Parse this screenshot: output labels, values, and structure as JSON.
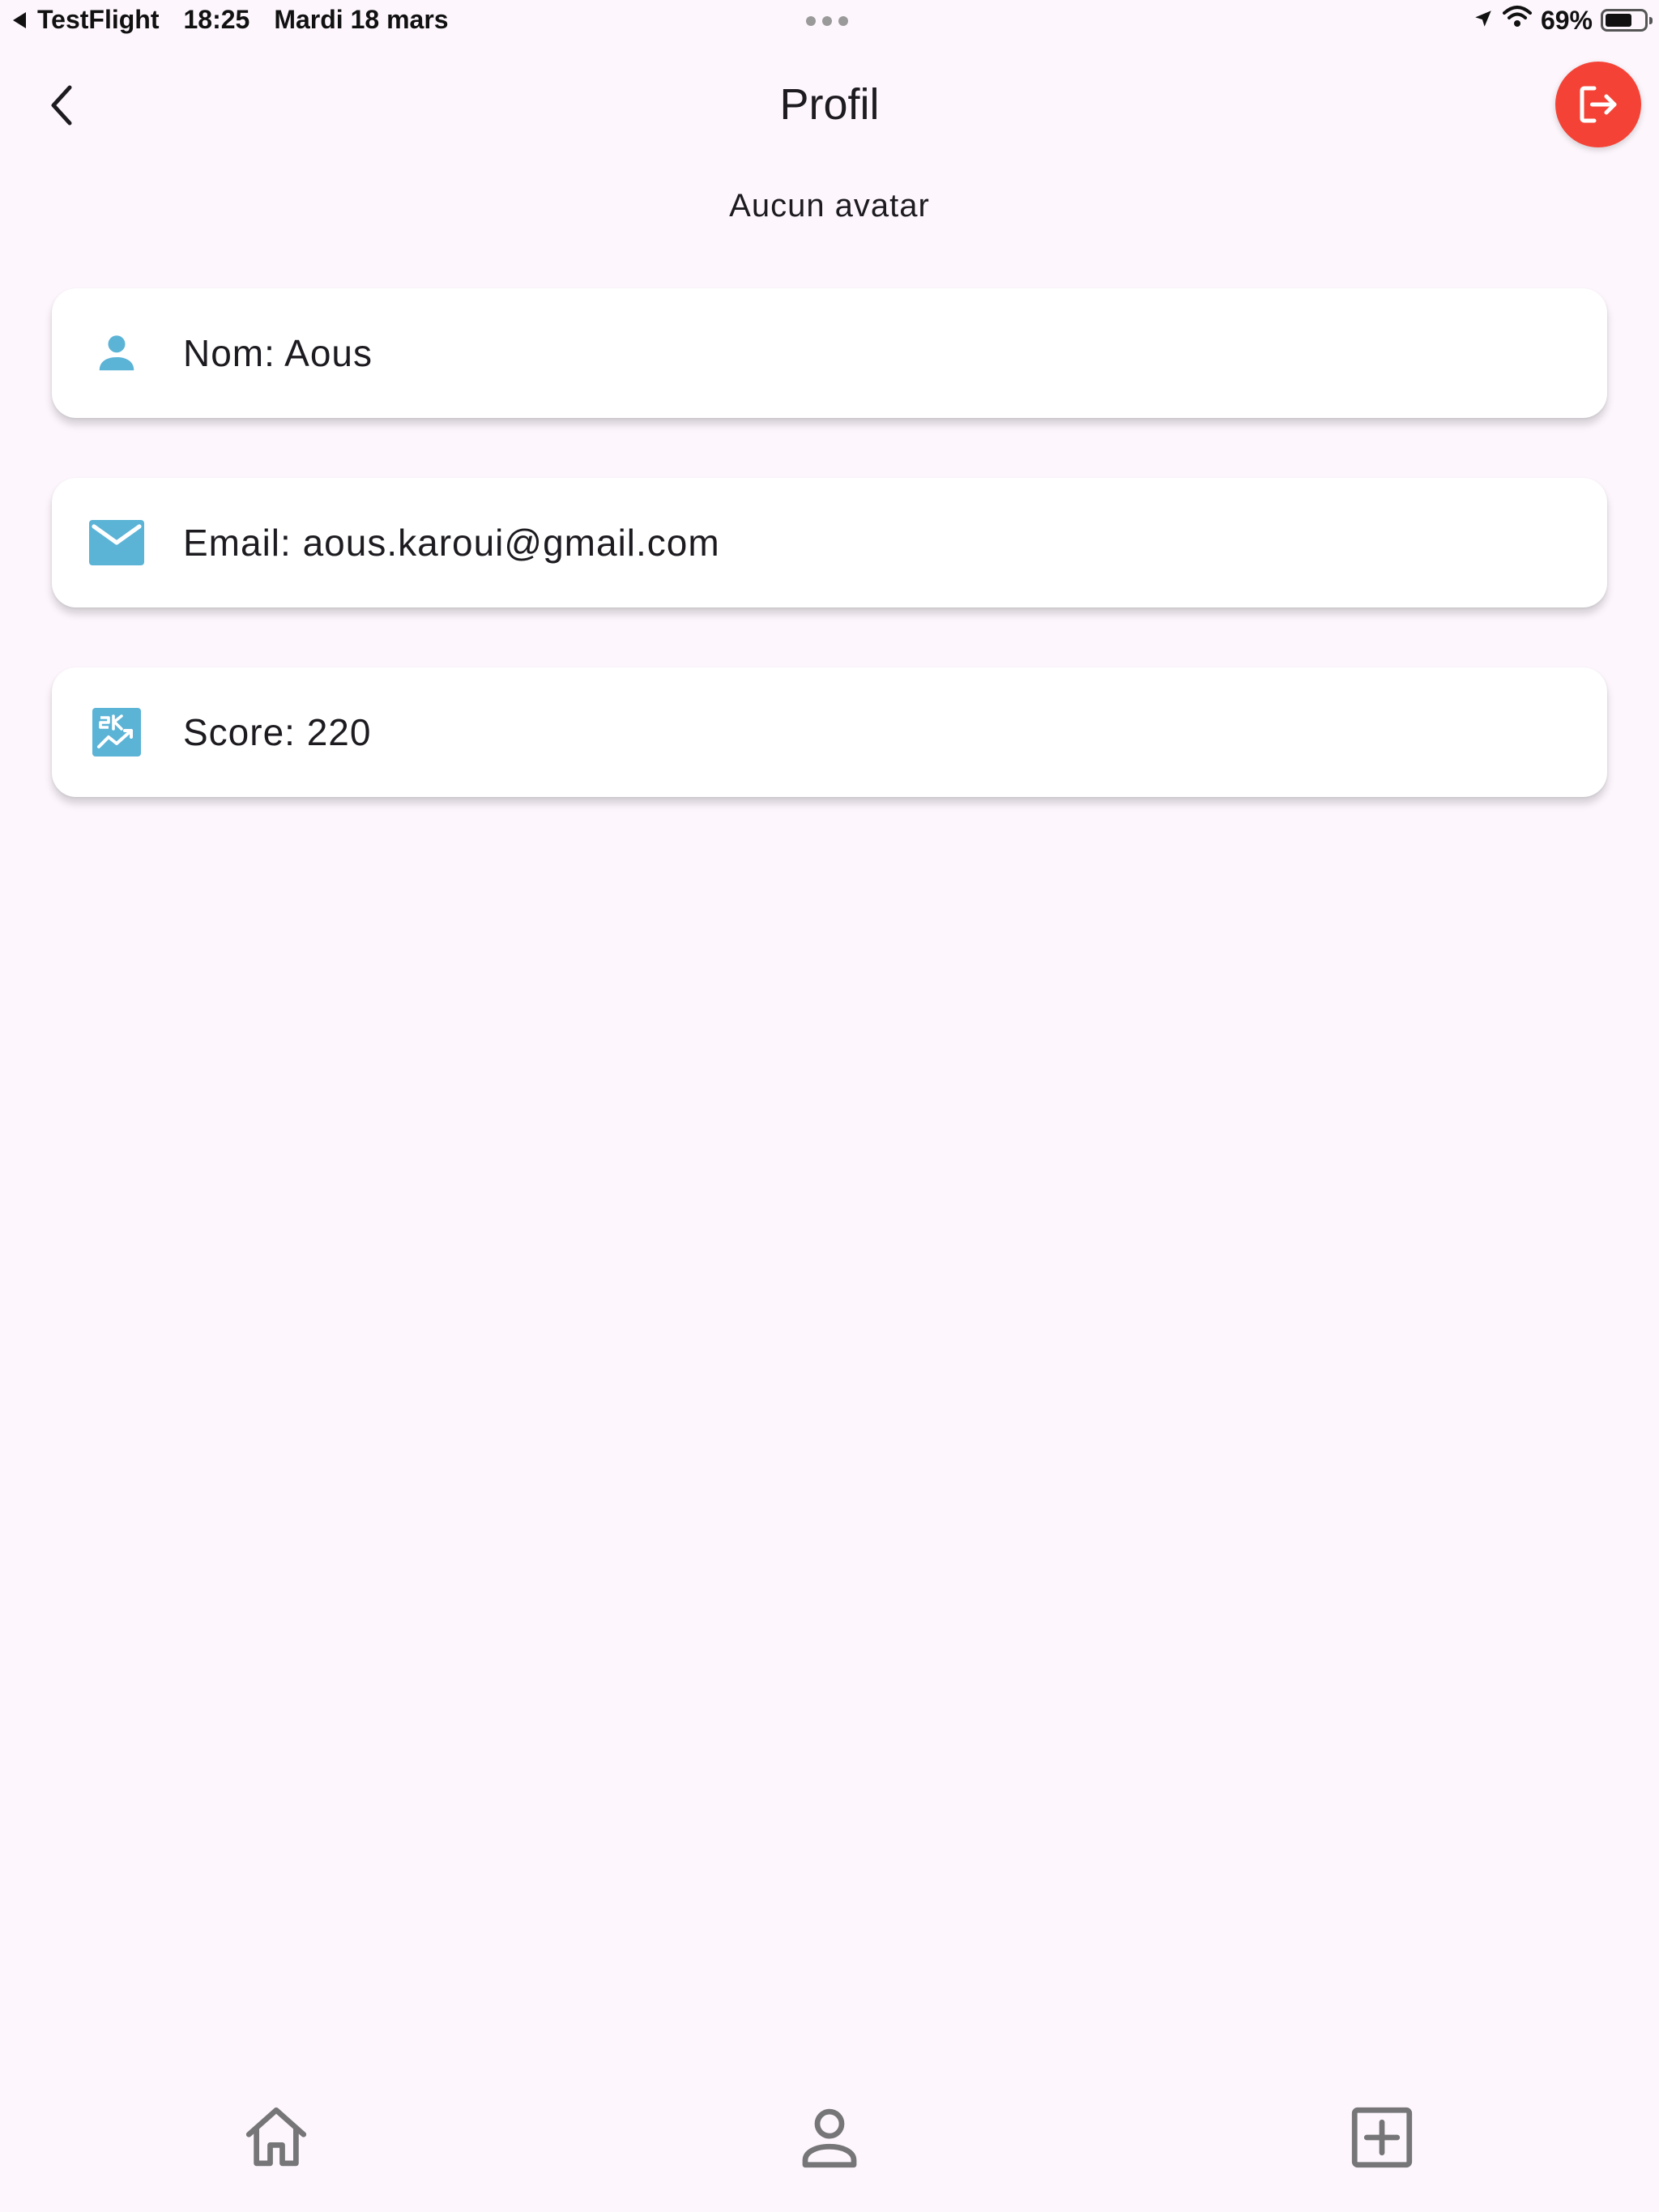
{
  "status_bar": {
    "back_app": "TestFlight",
    "time": "18:25",
    "date": "Mardi 18 mars",
    "battery": "69%",
    "battery_level": 0.69
  },
  "app_bar": {
    "title": "Profil",
    "back_icon": "chevron-left-icon",
    "logout_icon": "logout-icon",
    "logout_color": "#f44336"
  },
  "profile": {
    "avatar_text": "Aucun avatar",
    "items": [
      {
        "icon": "person-icon",
        "label": "Nom: Aous"
      },
      {
        "icon": "mail-icon",
        "label": "Email: aous.karoui@gmail.com"
      },
      {
        "icon": "score-icon",
        "label": "Score: 220"
      }
    ],
    "icon_color": "#5bb3d6"
  },
  "bottom_nav": {
    "items": [
      {
        "icon": "home-icon"
      },
      {
        "icon": "person-outline-icon"
      },
      {
        "icon": "add-box-icon"
      }
    ]
  }
}
